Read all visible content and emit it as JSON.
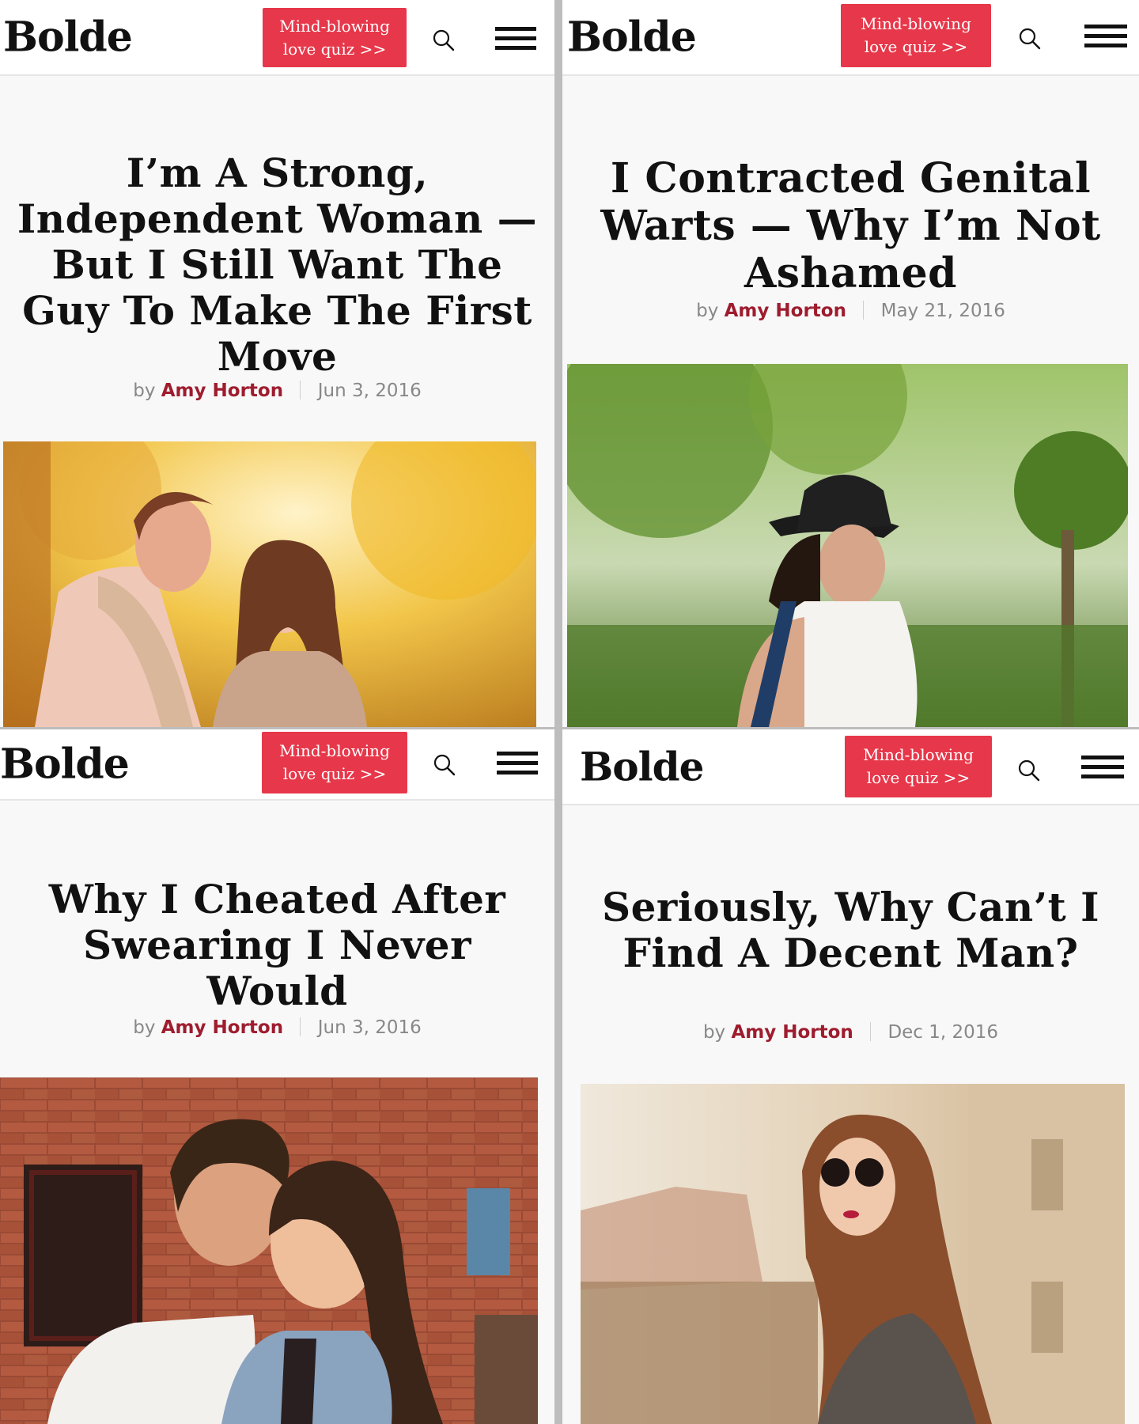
{
  "panels": [
    {
      "logo": "Bolde",
      "quiz_button": "Mind-blowing\nlove quiz >>",
      "title": "I’m A Strong, Independent Woman — But I Still Want The Guy To Make The First Move",
      "byline": {
        "prefix": "by",
        "author": "Amy Horton",
        "date": "Jun 3, 2016"
      },
      "photo_icon": "couple-autumn-photo"
    },
    {
      "logo": "Bolde",
      "quiz_button": "Mind-blowing\nlove quiz >>",
      "title": "I Contracted Genital Warts — Why I’m Not Ashamed",
      "byline": {
        "prefix": "by",
        "author": "Amy Horton",
        "date": "May 21, 2016"
      },
      "photo_icon": "woman-hat-photo"
    },
    {
      "logo": "Bolde",
      "quiz_button": "Mind-blowing\nlove quiz >>",
      "title": "Why I Cheated After Swearing I Never Would",
      "byline": {
        "prefix": "by",
        "author": "Amy Horton",
        "date": "Jun 3, 2016"
      },
      "photo_icon": "couple-brick-wall-photo"
    },
    {
      "logo": "Bolde",
      "quiz_button": "Mind-blowing\nlove quiz >>",
      "title": "Seriously, Why Can’t I Find A Decent Man?",
      "byline": {
        "prefix": "by",
        "author": "Amy Horton",
        "date": "Dec 1, 2016"
      },
      "photo_icon": "woman-sunglasses-photo"
    }
  ],
  "colors": {
    "accent": "#e7374a",
    "author": "#9e1c2e",
    "meta": "#888888",
    "text": "#111111"
  }
}
